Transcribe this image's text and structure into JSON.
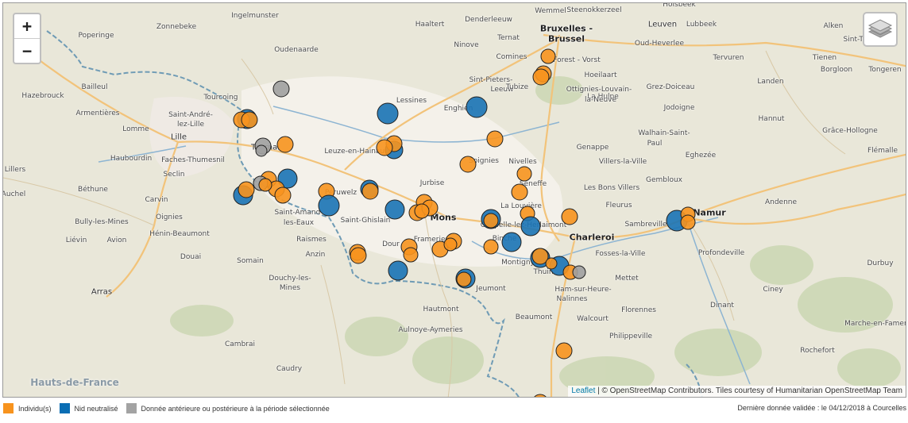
{
  "map": {
    "zoom_in_label": "+",
    "zoom_out_label": "−",
    "attribution": {
      "leaflet_label": "Leaflet",
      "separator": " | © ",
      "text": "OpenStreetMap Contributors. Tiles courtesy of Humanitarian OpenStreetMap Team"
    },
    "places": [
      {
        "name": "Ingelmunster",
        "cls": ""
      },
      {
        "name": "Zonnebeke",
        "cls": ""
      },
      {
        "name": "Poperinge",
        "cls": ""
      },
      {
        "name": "Oudenaarde",
        "cls": ""
      },
      {
        "name": "Haaltert",
        "cls": ""
      },
      {
        "name": "Denderleeuw",
        "cls": ""
      },
      {
        "name": "Wemmel",
        "cls": ""
      },
      {
        "name": "Steenokkerzeel",
        "cls": ""
      },
      {
        "name": "Holsbeek",
        "cls": ""
      },
      {
        "name": "Leuven",
        "cls": "city"
      },
      {
        "name": "Lubbeek",
        "cls": ""
      },
      {
        "name": "Alken",
        "cls": ""
      },
      {
        "name": "Bruxelles -",
        "cls": "big"
      },
      {
        "name": "Brussel",
        "cls": "big"
      },
      {
        "name": "Ninove",
        "cls": ""
      },
      {
        "name": "Ternat",
        "cls": ""
      },
      {
        "name": "Oud-Heverlee",
        "cls": ""
      },
      {
        "name": "Comines",
        "cls": ""
      },
      {
        "name": "Forest - Vorst",
        "cls": ""
      },
      {
        "name": "Tervuren",
        "cls": ""
      },
      {
        "name": "Tienen",
        "cls": ""
      },
      {
        "name": "Sint-Truiden",
        "cls": ""
      },
      {
        "name": "Bailleul",
        "cls": ""
      },
      {
        "name": "Tourcoing",
        "cls": ""
      },
      {
        "name": "Sint-Pieters-",
        "cls": ""
      },
      {
        "name": "Leeuw",
        "cls": ""
      },
      {
        "name": "Hoeilaart",
        "cls": ""
      },
      {
        "name": "Landen",
        "cls": ""
      },
      {
        "name": "Borgloon",
        "cls": ""
      },
      {
        "name": "Tongeren",
        "cls": ""
      },
      {
        "name": "Hazebrouck",
        "cls": ""
      },
      {
        "name": "Lessines",
        "cls": ""
      },
      {
        "name": "Grez-Doiceau",
        "cls": ""
      },
      {
        "name": "Armentières",
        "cls": ""
      },
      {
        "name": "Saint-André-",
        "cls": ""
      },
      {
        "name": "lez-Lille",
        "cls": ""
      },
      {
        "name": "Enghien",
        "cls": ""
      },
      {
        "name": "Tubize",
        "cls": ""
      },
      {
        "name": "La Hulpe",
        "cls": ""
      },
      {
        "name": "Ottignies-Louvain-",
        "cls": ""
      },
      {
        "name": "la-Neuve",
        "cls": ""
      },
      {
        "name": "Jodoigne",
        "cls": ""
      },
      {
        "name": "Hannut",
        "cls": ""
      },
      {
        "name": "Lomme",
        "cls": ""
      },
      {
        "name": "Lille",
        "cls": "city"
      },
      {
        "name": "Grâce-Hollogne",
        "cls": ""
      },
      {
        "name": "Flémalle",
        "cls": ""
      },
      {
        "name": "Tournai",
        "cls": "city"
      },
      {
        "name": "Leuze-en-Hainaut",
        "cls": ""
      },
      {
        "name": "Walhain-Saint-",
        "cls": ""
      },
      {
        "name": "Paul",
        "cls": ""
      },
      {
        "name": "Genappe",
        "cls": ""
      },
      {
        "name": "Eghezée",
        "cls": ""
      },
      {
        "name": "Haubourdin",
        "cls": ""
      },
      {
        "name": "Faches-Thumesnil",
        "cls": ""
      },
      {
        "name": "Soignies",
        "cls": ""
      },
      {
        "name": "Nivelles",
        "cls": ""
      },
      {
        "name": "Villers-la-Ville",
        "cls": ""
      },
      {
        "name": "Seclin",
        "cls": ""
      },
      {
        "name": "Lillers",
        "cls": ""
      },
      {
        "name": "Jurbise",
        "cls": ""
      },
      {
        "name": "Seneffe",
        "cls": ""
      },
      {
        "name": "Gembloux",
        "cls": ""
      },
      {
        "name": "Béthune",
        "cls": ""
      },
      {
        "name": "Péruwelz",
        "cls": ""
      },
      {
        "name": "Les Bons Villers",
        "cls": ""
      },
      {
        "name": "Auchel",
        "cls": ""
      },
      {
        "name": "Carvin",
        "cls": ""
      },
      {
        "name": "La Louvière",
        "cls": ""
      },
      {
        "name": "Fleurus",
        "cls": ""
      },
      {
        "name": "Andenne",
        "cls": ""
      },
      {
        "name": "Namur",
        "cls": "big"
      },
      {
        "name": "Saint-Amand-",
        "cls": ""
      },
      {
        "name": "les-Eaux",
        "cls": ""
      },
      {
        "name": "Mons",
        "cls": "big"
      },
      {
        "name": "Saint-Ghislain",
        "cls": ""
      },
      {
        "name": "Bully-les-Mines",
        "cls": ""
      },
      {
        "name": "Oignies",
        "cls": ""
      },
      {
        "name": "Chapelle-lez-Herlaimont",
        "cls": ""
      },
      {
        "name": "Sambreville",
        "cls": ""
      },
      {
        "name": "Hénin-Beaumont",
        "cls": ""
      },
      {
        "name": "Liévin",
        "cls": ""
      },
      {
        "name": "Avion",
        "cls": ""
      },
      {
        "name": "Raismes",
        "cls": ""
      },
      {
        "name": "Frameries",
        "cls": ""
      },
      {
        "name": "Binche",
        "cls": ""
      },
      {
        "name": "Charleroi",
        "cls": "big"
      },
      {
        "name": "Profondeville",
        "cls": ""
      },
      {
        "name": "Douai",
        "cls": ""
      },
      {
        "name": "Anzin",
        "cls": ""
      },
      {
        "name": "Dour",
        "cls": ""
      },
      {
        "name": "Fosses-la-Ville",
        "cls": ""
      },
      {
        "name": "Montigny",
        "cls": ""
      },
      {
        "name": "Somain",
        "cls": ""
      },
      {
        "name": "Thuin",
        "cls": ""
      },
      {
        "name": "Durbuy",
        "cls": ""
      },
      {
        "name": "Mettet",
        "cls": ""
      },
      {
        "name": "Douchy-les-",
        "cls": ""
      },
      {
        "name": "Mines",
        "cls": ""
      },
      {
        "name": "Ham-sur-Heure-",
        "cls": ""
      },
      {
        "name": "Nalinnes",
        "cls": ""
      },
      {
        "name": "Jeumont",
        "cls": ""
      },
      {
        "name": "Ciney",
        "cls": ""
      },
      {
        "name": "Arras",
        "cls": "city"
      },
      {
        "name": "Hautmont",
        "cls": ""
      },
      {
        "name": "Dinant",
        "cls": ""
      },
      {
        "name": "Florennes",
        "cls": ""
      },
      {
        "name": "Aulnoye-Aymeries",
        "cls": ""
      },
      {
        "name": "Beaumont",
        "cls": ""
      },
      {
        "name": "Walcourt",
        "cls": ""
      },
      {
        "name": "Marche-en-Famenne",
        "cls": ""
      },
      {
        "name": "Philippeville",
        "cls": ""
      },
      {
        "name": "Cambrai",
        "cls": ""
      },
      {
        "name": "Rochefort",
        "cls": ""
      },
      {
        "name": "Caudry",
        "cls": ""
      },
      {
        "name": "Hauts-de-France",
        "cls": "region"
      }
    ]
  },
  "legend": {
    "items": [
      {
        "label": "Individu(s)",
        "color": "#f7931e"
      },
      {
        "label": "Nid neutralisé",
        "color": "#0a6eb4"
      },
      {
        "label": "Donnée antérieure ou postérieure à la période sélectionnée",
        "color": "#a3a3a3"
      }
    ],
    "last_data": "Dernière donnée validée : le 04/12/2018 à Courcelles"
  },
  "colors": {
    "individual": "#f7931e",
    "nest": "#1a73b5",
    "other": "#a0a0a0"
  }
}
